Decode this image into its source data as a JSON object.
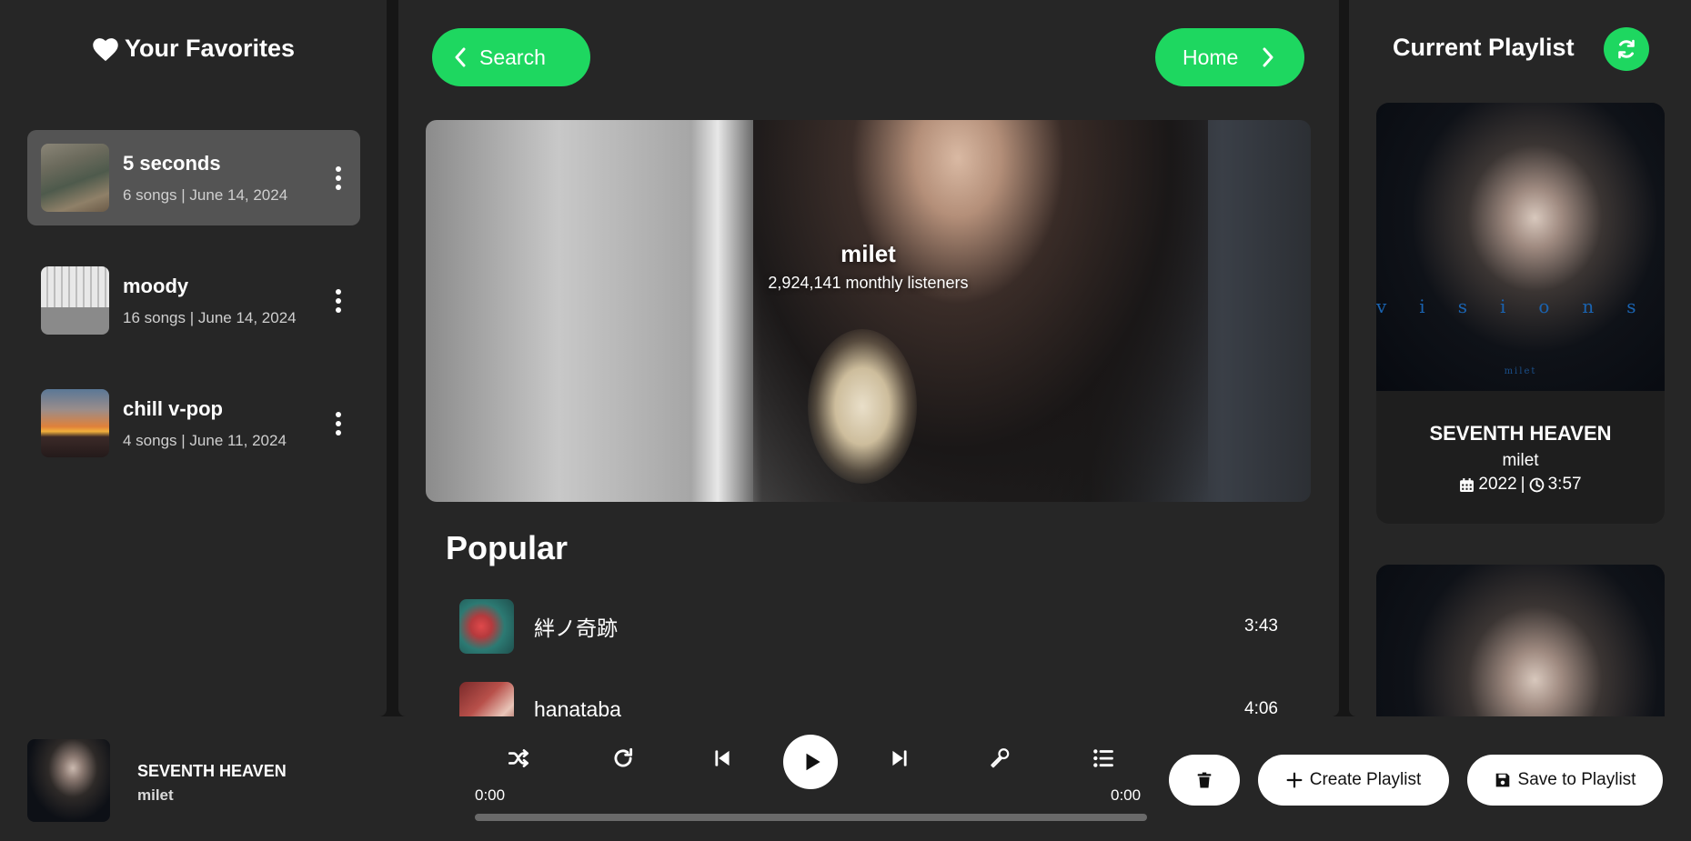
{
  "colors": {
    "accent": "#1ed760",
    "panel": "#262626",
    "active_item": "#545454"
  },
  "left": {
    "title": "Your Favorites",
    "title_icon": "heart-icon",
    "items": [
      {
        "name": "5 seconds",
        "meta": "6 songs | June 14, 2024",
        "active": true
      },
      {
        "name": "moody",
        "meta": "16 songs | June 14, 2024",
        "active": false
      },
      {
        "name": "chill v-pop",
        "meta": "4 songs | June 11, 2024",
        "active": false
      }
    ]
  },
  "center": {
    "nav": {
      "back_label": "Search",
      "forward_label": "Home"
    },
    "artist": {
      "name": "milet",
      "listeners": "2,924,141 monthly listeners"
    },
    "popular_title": "Popular",
    "songs": [
      {
        "title": "絆ノ奇跡",
        "duration": "3:43"
      },
      {
        "title": "hanataba",
        "duration": "4:06"
      }
    ]
  },
  "right": {
    "title": "Current Playlist",
    "cards": [
      {
        "art_text": "visions",
        "art_sub": "milet",
        "title": "SEVENTH HEAVEN",
        "artist": "milet",
        "year": "2022",
        "duration": "3:57"
      },
      {
        "art_text": "",
        "art_sub": ""
      }
    ]
  },
  "player": {
    "now_playing": {
      "title": "SEVENTH HEAVEN",
      "artist": "milet"
    },
    "time_current": "0:00",
    "time_total": "0:00",
    "progress": 0,
    "buttons": {
      "create_playlist": "Create Playlist",
      "save_to_playlist": "Save to Playlist"
    }
  }
}
